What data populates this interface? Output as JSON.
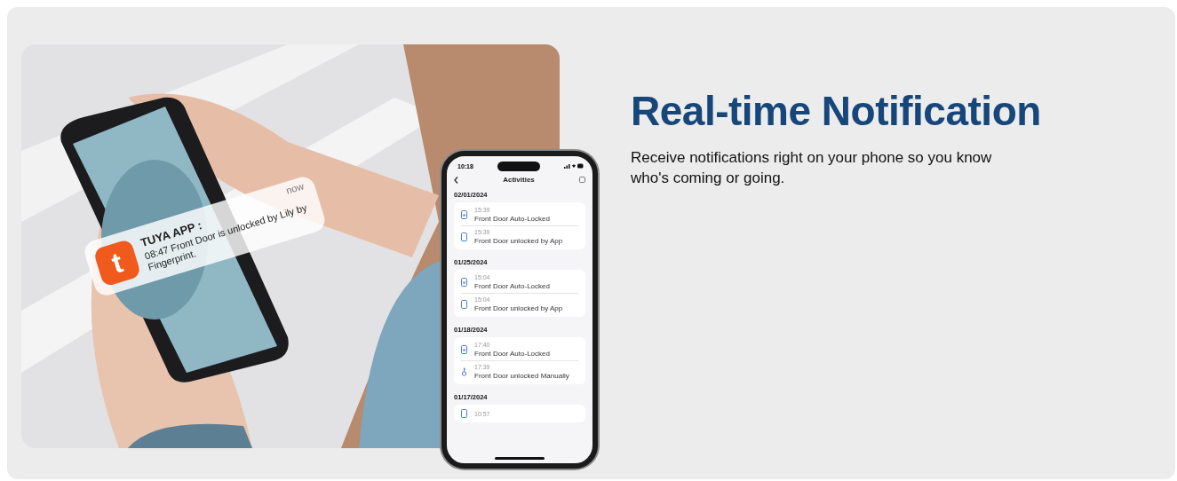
{
  "heading": "Real-time Notification",
  "description": "Receive notifications right on your phone so you know who's coming or going.",
  "notification": {
    "app": "TUYA APP :",
    "message": "08:47 Front Door is unlocked by Lily by Fingerprint.",
    "time": "now",
    "logo_letter": "t"
  },
  "phone": {
    "status_time": "10:18",
    "title": "Activities",
    "days": [
      {
        "date": "02/01/2024",
        "events": [
          {
            "kind": "auto",
            "time": "15:39",
            "text": "Front Door Auto-Locked"
          },
          {
            "kind": "app",
            "time": "15:39",
            "text": "Front Door unlocked by App"
          }
        ]
      },
      {
        "date": "01/25/2024",
        "events": [
          {
            "kind": "auto",
            "time": "15:04",
            "text": "Front Door Auto-Locked"
          },
          {
            "kind": "app",
            "time": "15:04",
            "text": "Front Door unlocked by App"
          }
        ]
      },
      {
        "date": "01/18/2024",
        "events": [
          {
            "kind": "auto",
            "time": "17:40",
            "text": "Front Door Auto-Locked"
          },
          {
            "kind": "manual",
            "time": "17:39",
            "text": "Front Door unlocked Manually"
          }
        ]
      },
      {
        "date": "01/17/2024",
        "events": [
          {
            "kind": "app",
            "time": "10:57"
          }
        ]
      }
    ]
  }
}
